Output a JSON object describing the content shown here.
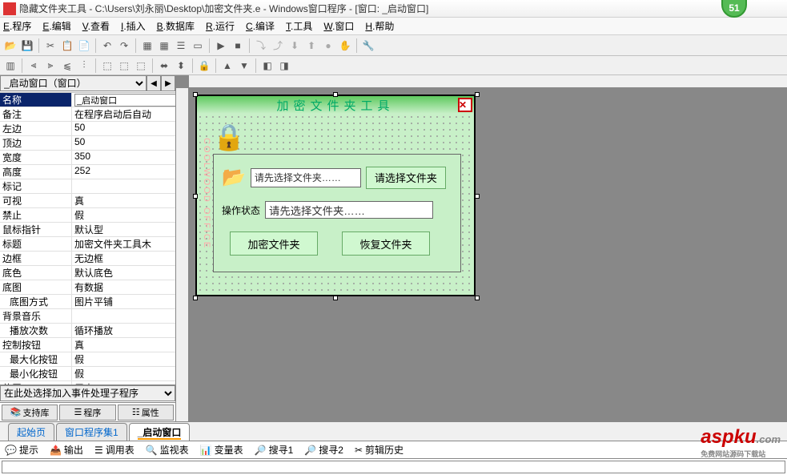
{
  "title": "隐藏文件夹工具 - C:\\Users\\刘永丽\\Desktop\\加密文件夹.e - Windows窗口程序 - [窗口: _启动窗口]",
  "badge": "51",
  "menu": [
    "E.程序",
    "E.编辑",
    "V.查看",
    "I.插入",
    "B.数据库",
    "R.运行",
    "C.编译",
    "T.工具",
    "W.窗口",
    "H.帮助"
  ],
  "dropdown": "_启动窗口（窗口）",
  "props": [
    {
      "n": "名称",
      "v": "_启动窗口",
      "sel": true
    },
    {
      "n": "备注",
      "v": "在程序启动后自动"
    },
    {
      "n": "左边",
      "v": "50"
    },
    {
      "n": "顶边",
      "v": "50"
    },
    {
      "n": "宽度",
      "v": "350"
    },
    {
      "n": "高度",
      "v": "252"
    },
    {
      "n": "标记",
      "v": ""
    },
    {
      "n": "可视",
      "v": "真"
    },
    {
      "n": "禁止",
      "v": "假"
    },
    {
      "n": "鼠标指针",
      "v": "默认型"
    },
    {
      "n": "标题",
      "v": "加密文件夹工具木"
    },
    {
      "n": "边框",
      "v": "无边框"
    },
    {
      "n": "底色",
      "v": "默认底色"
    },
    {
      "n": "底图",
      "v": "有数据"
    },
    {
      "n": "底图方式",
      "v": "图片平铺",
      "indent": true
    },
    {
      "n": "背景音乐",
      "v": ""
    },
    {
      "n": "播放次数",
      "v": "循环播放",
      "indent": true
    },
    {
      "n": "控制按钮",
      "v": "真"
    },
    {
      "n": "最大化按钮",
      "v": "假",
      "indent": true
    },
    {
      "n": "最小化按钮",
      "v": "假",
      "indent": true
    },
    {
      "n": "位置",
      "v": "居中"
    }
  ],
  "event_combo": "在此处选择加入事件处理子程序",
  "left_buttons": {
    "lib": "支持库",
    "prog": "程序",
    "attr": "属性"
  },
  "form": {
    "title": "加密文件夹工具",
    "path_placeholder": "请先选择文件夹……",
    "browse_btn": "请选择文件夹",
    "status_label": "操作状态",
    "status_value": "请先选择文件夹……",
    "encrypt_btn": "加密文件夹",
    "restore_btn": "恢复文件夹",
    "side": "COOLWOOD OFFICE"
  },
  "tabs": [
    "起始页",
    "窗口程序集1",
    "_启动窗口"
  ],
  "status_tabs": [
    "提示",
    "输出",
    "调用表",
    "监视表",
    "变量表",
    "搜寻1",
    "搜寻2",
    "剪辑历史"
  ],
  "watermark": "aspku",
  "watermark_sub": "免费网站源码下载站"
}
